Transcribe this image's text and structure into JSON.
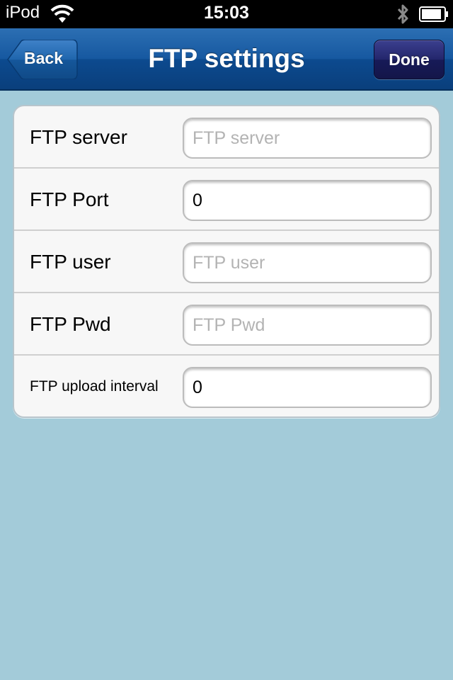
{
  "status_bar": {
    "carrier": "iPod",
    "time": "15:03",
    "wifi_icon": "wifi-icon",
    "bluetooth_icon": "bluetooth-icon",
    "battery_icon": "battery-icon",
    "battery_level": 0.9
  },
  "nav": {
    "title": "FTP settings",
    "back_label": "Back",
    "done_label": "Done"
  },
  "form": {
    "rows": [
      {
        "label": "FTP server",
        "value": "",
        "placeholder": "FTP server"
      },
      {
        "label": "FTP Port",
        "value": "0",
        "placeholder": ""
      },
      {
        "label": "FTP user",
        "value": "",
        "placeholder": "FTP user"
      },
      {
        "label": "FTP Pwd",
        "value": "",
        "placeholder": "FTP Pwd"
      },
      {
        "label": "FTP upload interval",
        "value": "0",
        "placeholder": ""
      }
    ]
  },
  "colors": {
    "background": "#a3cbd9",
    "navbar": "#1658a0",
    "done_button": "#23266c"
  }
}
